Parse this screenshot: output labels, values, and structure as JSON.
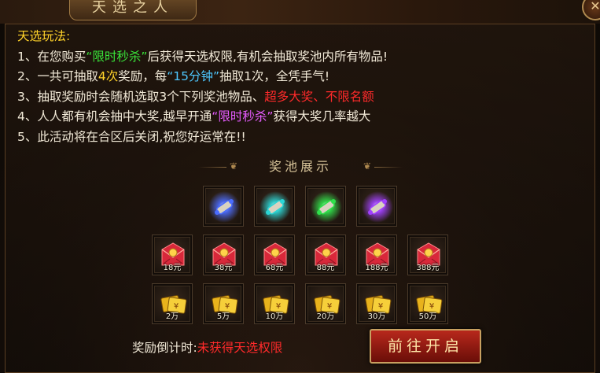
{
  "window": {
    "title": "天选之人",
    "close_glyph": "✕"
  },
  "rules": {
    "heading": "天选玩法:",
    "lines": [
      [
        {
          "t": "1、在您购买"
        },
        {
          "t": "“限时秒杀”",
          "c": "green"
        },
        {
          "t": "后获得天选权限,有机会抽取奖池内所有物品!"
        }
      ],
      [
        {
          "t": "2、一共可抽取"
        },
        {
          "t": "4次",
          "c": "yellow"
        },
        {
          "t": "奖励，每"
        },
        {
          "t": "“15分钟”",
          "c": "cyan"
        },
        {
          "t": "抽取1次，全凭手气!"
        }
      ],
      [
        {
          "t": "3、抽取奖励时会随机选取3个下列奖池物品、"
        },
        {
          "t": "超多大奖、不限名额",
          "c": "red"
        }
      ],
      [
        {
          "t": "4、人人都有机会抽中大奖,越早开通"
        },
        {
          "t": "“限时秒杀”",
          "c": "purple"
        },
        {
          "t": "获得大奖几率越大"
        }
      ],
      [
        {
          "t": "5、此活动将在合区后关闭,祝您好运常在!!"
        }
      ]
    ]
  },
  "pool": {
    "title": "奖池展示",
    "rows": [
      [
        {
          "icon": "scroll-icon",
          "color": "#4a6cff",
          "label": ""
        },
        {
          "icon": "scroll-icon",
          "color": "#2ad6d6",
          "label": ""
        },
        {
          "icon": "scroll-icon",
          "color": "#2ee04a",
          "label": ""
        },
        {
          "icon": "scroll-icon",
          "color": "#a040ff",
          "label": ""
        }
      ],
      [
        {
          "icon": "red-envelope-icon",
          "color": "#d8283a",
          "label": "18元"
        },
        {
          "icon": "red-envelope-icon",
          "color": "#d8283a",
          "label": "38元"
        },
        {
          "icon": "red-envelope-icon",
          "color": "#d8283a",
          "label": "68元"
        },
        {
          "icon": "red-envelope-icon",
          "color": "#d8283a",
          "label": "88元"
        },
        {
          "icon": "red-envelope-icon",
          "color": "#d8283a",
          "label": "188元"
        },
        {
          "icon": "red-envelope-icon",
          "color": "#d8283a",
          "label": "388元"
        }
      ],
      [
        {
          "icon": "gold-ingot-icon",
          "color": "#e8b21c",
          "label": "2万"
        },
        {
          "icon": "gold-ingot-icon",
          "color": "#e8b21c",
          "label": "5万"
        },
        {
          "icon": "gold-ingot-icon",
          "color": "#e8b21c",
          "label": "10万"
        },
        {
          "icon": "gold-ingot-icon",
          "color": "#e8b21c",
          "label": "20万"
        },
        {
          "icon": "gold-ingot-icon",
          "color": "#e8b21c",
          "label": "30万"
        },
        {
          "icon": "gold-ingot-icon",
          "color": "#e8b21c",
          "label": "50万"
        }
      ]
    ]
  },
  "footer": {
    "countdown_label": "奖励倒计时:",
    "countdown_status": "未获得天选权限",
    "go_button": "前往开启"
  },
  "colors": {
    "green": "#39e339",
    "yellow": "#ffd32a",
    "cyan": "#4ec8ff",
    "red": "#ff2a2a",
    "purple": "#e65cff"
  }
}
